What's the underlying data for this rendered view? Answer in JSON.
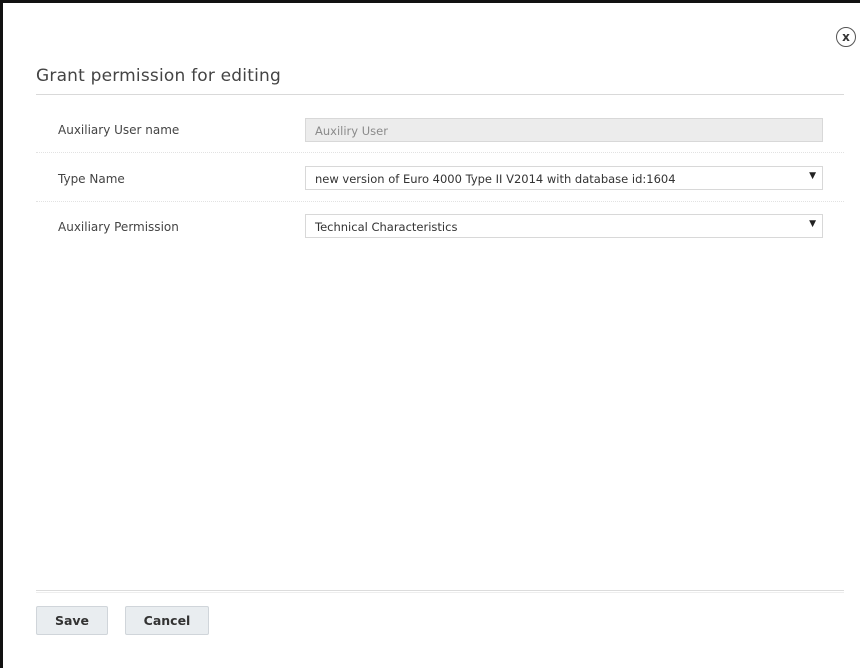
{
  "dialog": {
    "title": "Grant permission for editing",
    "close_icon": "close-icon",
    "close_glyph": "x"
  },
  "form": {
    "auxiliary_user": {
      "label": "Auxiliary User name",
      "value": "Auxiliry User"
    },
    "type_name": {
      "label": "Type Name",
      "value": "new version of Euro 4000 Type II V2014 with database id:1604",
      "arrow": "▼"
    },
    "auxiliary_permission": {
      "label": "Auxiliary Permission",
      "value": "Technical Characteristics",
      "arrow": "▼"
    }
  },
  "footer": {
    "save_label": "Save",
    "cancel_label": "Cancel"
  }
}
